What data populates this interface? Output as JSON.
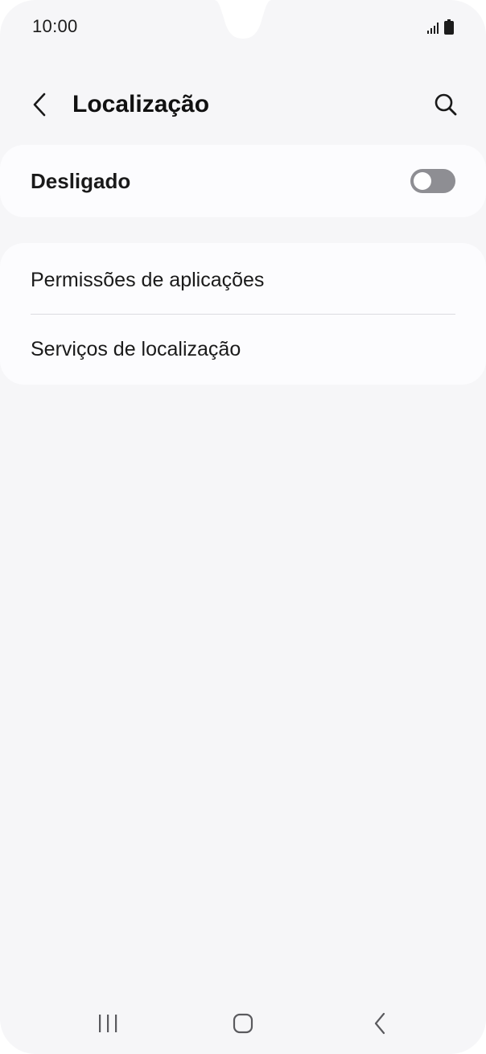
{
  "status_bar": {
    "time": "10:00",
    "signal_icon": "signal-icon",
    "battery_icon": "battery-icon"
  },
  "header": {
    "title": "Localização",
    "back_icon": "chevron-left-icon",
    "search_icon": "search-icon"
  },
  "location_toggle": {
    "label": "Desligado",
    "enabled": false
  },
  "menu": {
    "items": [
      {
        "label": "Permissões de aplicações"
      },
      {
        "label": "Serviços de localização"
      }
    ]
  },
  "nav_bar": {
    "recents_icon": "recents-icon",
    "home_icon": "home-icon",
    "back_icon": "back-icon"
  },
  "colors": {
    "background": "#f6f6f8",
    "card": "#fcfcfe",
    "switch_off": "#8e8e93",
    "text": "#1a1a1a"
  }
}
